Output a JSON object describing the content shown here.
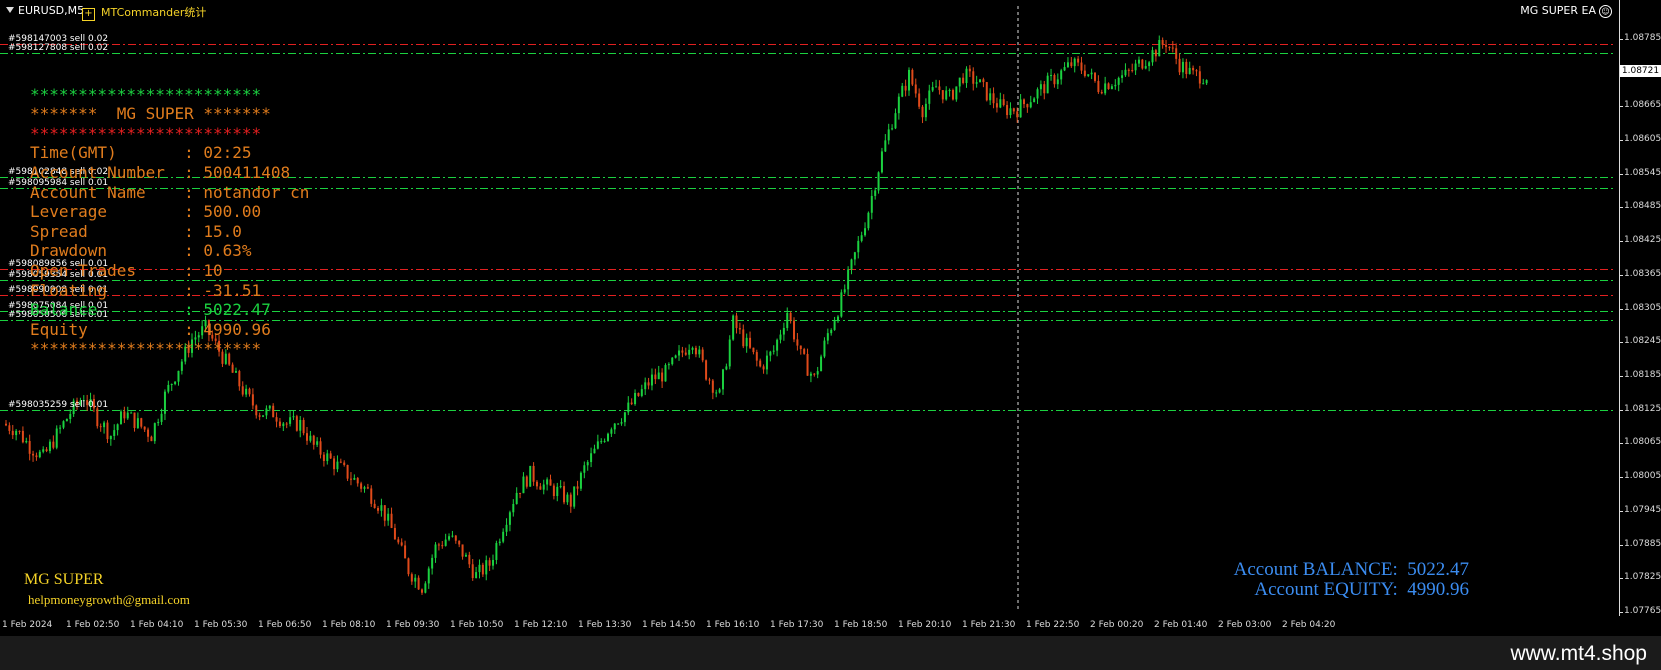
{
  "topbar": {
    "symbol": "EURUSD,M5",
    "plugin": "MTCommander统计",
    "ea_name": "MG SUPER EA"
  },
  "price_axis": {
    "ticks": [
      "1.08785",
      "1.08721",
      "1.08665",
      "1.08605",
      "1.08545",
      "1.08485",
      "1.08425",
      "1.08365",
      "1.08305",
      "1.08245",
      "1.08185",
      "1.08125",
      "1.08065",
      "1.08005",
      "1.07945",
      "1.07885",
      "1.07825",
      "1.07765"
    ],
    "current_price": "1.08721"
  },
  "time_axis": {
    "ticks": [
      "1 Feb 2024",
      "1 Feb 02:50",
      "1 Feb 04:10",
      "1 Feb 05:30",
      "1 Feb 06:50",
      "1 Feb 08:10",
      "1 Feb 09:30",
      "1 Feb 10:50",
      "1 Feb 12:10",
      "1 Feb 13:30",
      "1 Feb 14:50",
      "1 Feb 16:10",
      "1 Feb 17:30",
      "1 Feb 18:50",
      "1 Feb 20:10",
      "1 Feb 21:30",
      "1 Feb 22:50",
      "2 Feb 00:20",
      "2 Feb 01:40",
      "2 Feb 03:00",
      "2 Feb 04:20"
    ]
  },
  "orders": [
    {
      "label": "#598147003 sell 0.02",
      "price": 1.08775,
      "color": "#e32020"
    },
    {
      "label": "#598127808 sell 0.02",
      "price": 1.0876,
      "color": "#1bd140"
    },
    {
      "label": "#598102848 sell 0.02",
      "price": 1.0854,
      "color": "#1bd140"
    },
    {
      "label": "#598095984 sell 0.01",
      "price": 1.0852,
      "color": "#1bd140"
    },
    {
      "label": "#598089856 sell 0.01",
      "price": 1.08375,
      "color": "#e32020"
    },
    {
      "label": "#598059354 sell 0.01",
      "price": 1.08355,
      "color": "#1bd140"
    },
    {
      "label": "#598090908 sell 0.01",
      "price": 1.0833,
      "color": "#e32020"
    },
    {
      "label": "#598075084 sell 0.01",
      "price": 1.083,
      "color": "#1bd140"
    },
    {
      "label": "#598050506 sell 0.01",
      "price": 1.08285,
      "color": "#1bd140"
    },
    {
      "label": "#598035259 sell 0.01",
      "price": 1.08125,
      "color": "#1bd140"
    }
  ],
  "info_panel": {
    "stars_top": "************************",
    "title": "*******  MG SUPER *******",
    "stars_mid": "************************",
    "rows": [
      {
        "key": "Time(GMT)",
        "value": "02:25"
      },
      {
        "key": "Account Number",
        "value": "500411408"
      },
      {
        "key": "Account Name",
        "value": "notandor cn"
      },
      {
        "key": "Leverage",
        "value": "500.00"
      },
      {
        "key": "Spread",
        "value": "15.0"
      },
      {
        "key": "Drawdown",
        "value": "0.63%"
      },
      {
        "key": "Open Trades",
        "value": "10"
      },
      {
        "key": "Floating",
        "value": "-31.51"
      },
      {
        "key": "Balance",
        "value": "5022.47"
      },
      {
        "key": "Equity",
        "value": "4990.96"
      }
    ],
    "stars_bottom": "************************"
  },
  "brand": {
    "name": "MG SUPER",
    "email": "helpmoneygrowth@gmail.com"
  },
  "account_summary": {
    "balance_label": "Account BALANCE:",
    "balance": "5022.47",
    "equity_label": "Account EQUITY:",
    "equity": "4990.96"
  },
  "footer": {
    "watermark": "www.mt4.shop"
  },
  "colors": {
    "bull": "#1bd140",
    "bear": "#e04a1a",
    "panel_text": "#e07c1d",
    "summary_text": "#3b8cf0",
    "brand_text": "#f5d328"
  },
  "chart_data": {
    "type": "candlestick",
    "ylim": [
      1.07765,
      1.08815
    ],
    "close_path": [
      1.081,
      1.0809,
      1.0806,
      1.0804,
      1.0808,
      1.0812,
      1.0815,
      1.0811,
      1.0808,
      1.0812,
      1.081,
      1.0808,
      1.0815,
      1.082,
      1.0825,
      1.0827,
      1.0823,
      1.0819,
      1.0815,
      1.0812,
      1.0812,
      1.081,
      1.081,
      1.0806,
      1.0804,
      1.0802,
      1.08,
      1.0798,
      1.0795,
      1.079,
      1.0784,
      1.0781,
      1.0788,
      1.079,
      1.0787,
      1.0783,
      1.0785,
      1.0792,
      1.0798,
      1.0801,
      1.0799,
      1.0798,
      1.0796,
      1.0802,
      1.0806,
      1.081,
      1.0812,
      1.0815,
      1.0818,
      1.0819,
      1.0822,
      1.0825,
      1.0819,
      1.0815,
      1.0828,
      1.0824,
      1.082,
      1.0823,
      1.083,
      1.0822,
      1.0818,
      1.0826,
      1.0832,
      1.084,
      1.0848,
      1.0858,
      1.0866,
      1.0872,
      1.0866,
      1.087,
      1.0868,
      1.0872,
      1.0871,
      1.0868,
      1.0866,
      1.0866,
      1.0868,
      1.087,
      1.0872,
      1.0874,
      1.0873,
      1.087,
      1.0871,
      1.0872,
      1.0874,
      1.0876,
      1.0878,
      1.0874,
      1.0872,
      1.0872
    ]
  }
}
